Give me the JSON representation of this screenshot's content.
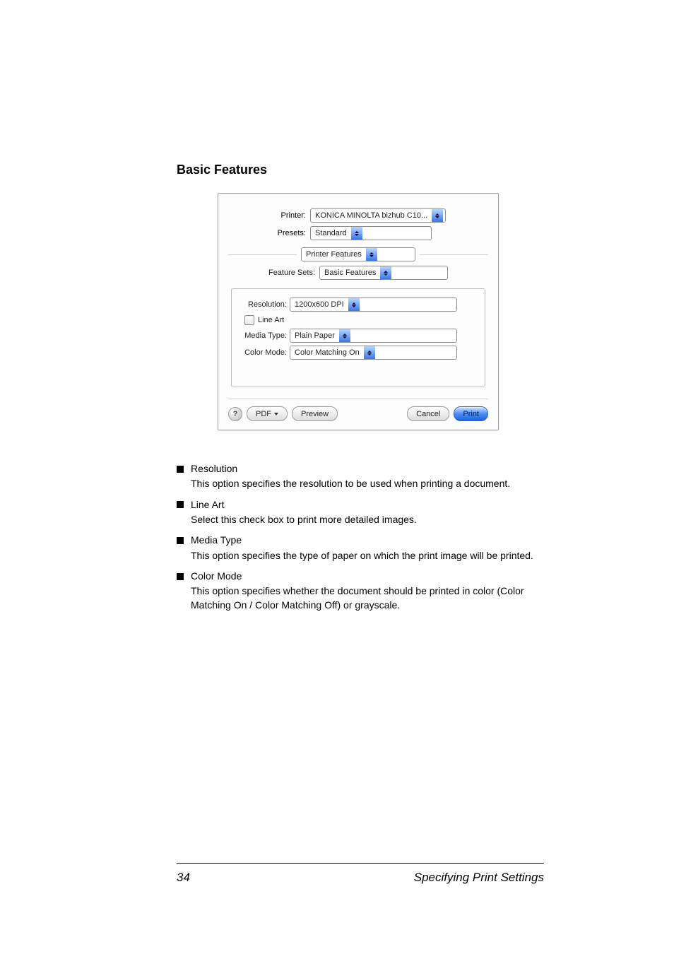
{
  "heading": "Basic Features",
  "dialog": {
    "printer_label": "Printer:",
    "printer_value": "KONICA MINOLTA bizhub C10...",
    "presets_label": "Presets:",
    "presets_value": "Standard",
    "section_select": "Printer Features",
    "feature_sets_label": "Feature Sets:",
    "feature_sets_value": "Basic Features",
    "resolution_label": "Resolution:",
    "resolution_value": "1200x600 DPI",
    "lineart_label": "Line Art",
    "mediatype_label": "Media Type:",
    "mediatype_value": "Plain Paper",
    "colormode_label": "Color Mode:",
    "colormode_value": "Color Matching On",
    "help_glyph": "?",
    "pdf_label": "PDF",
    "preview_label": "Preview",
    "cancel_label": "Cancel",
    "print_label": "Print"
  },
  "bullets": [
    {
      "title": "Resolution",
      "body": "This option specifies the resolution to be used when printing a document."
    },
    {
      "title": "Line Art",
      "body": "Select this check box to print more detailed images."
    },
    {
      "title": "Media Type",
      "body": "This option specifies the type of paper on which the print image will be printed."
    },
    {
      "title": "Color Mode",
      "body": "This option specifies whether the document should be printed in color (Color Matching On / Color Matching Off) or grayscale."
    }
  ],
  "footer": {
    "page": "34",
    "title": "Specifying Print Settings"
  }
}
